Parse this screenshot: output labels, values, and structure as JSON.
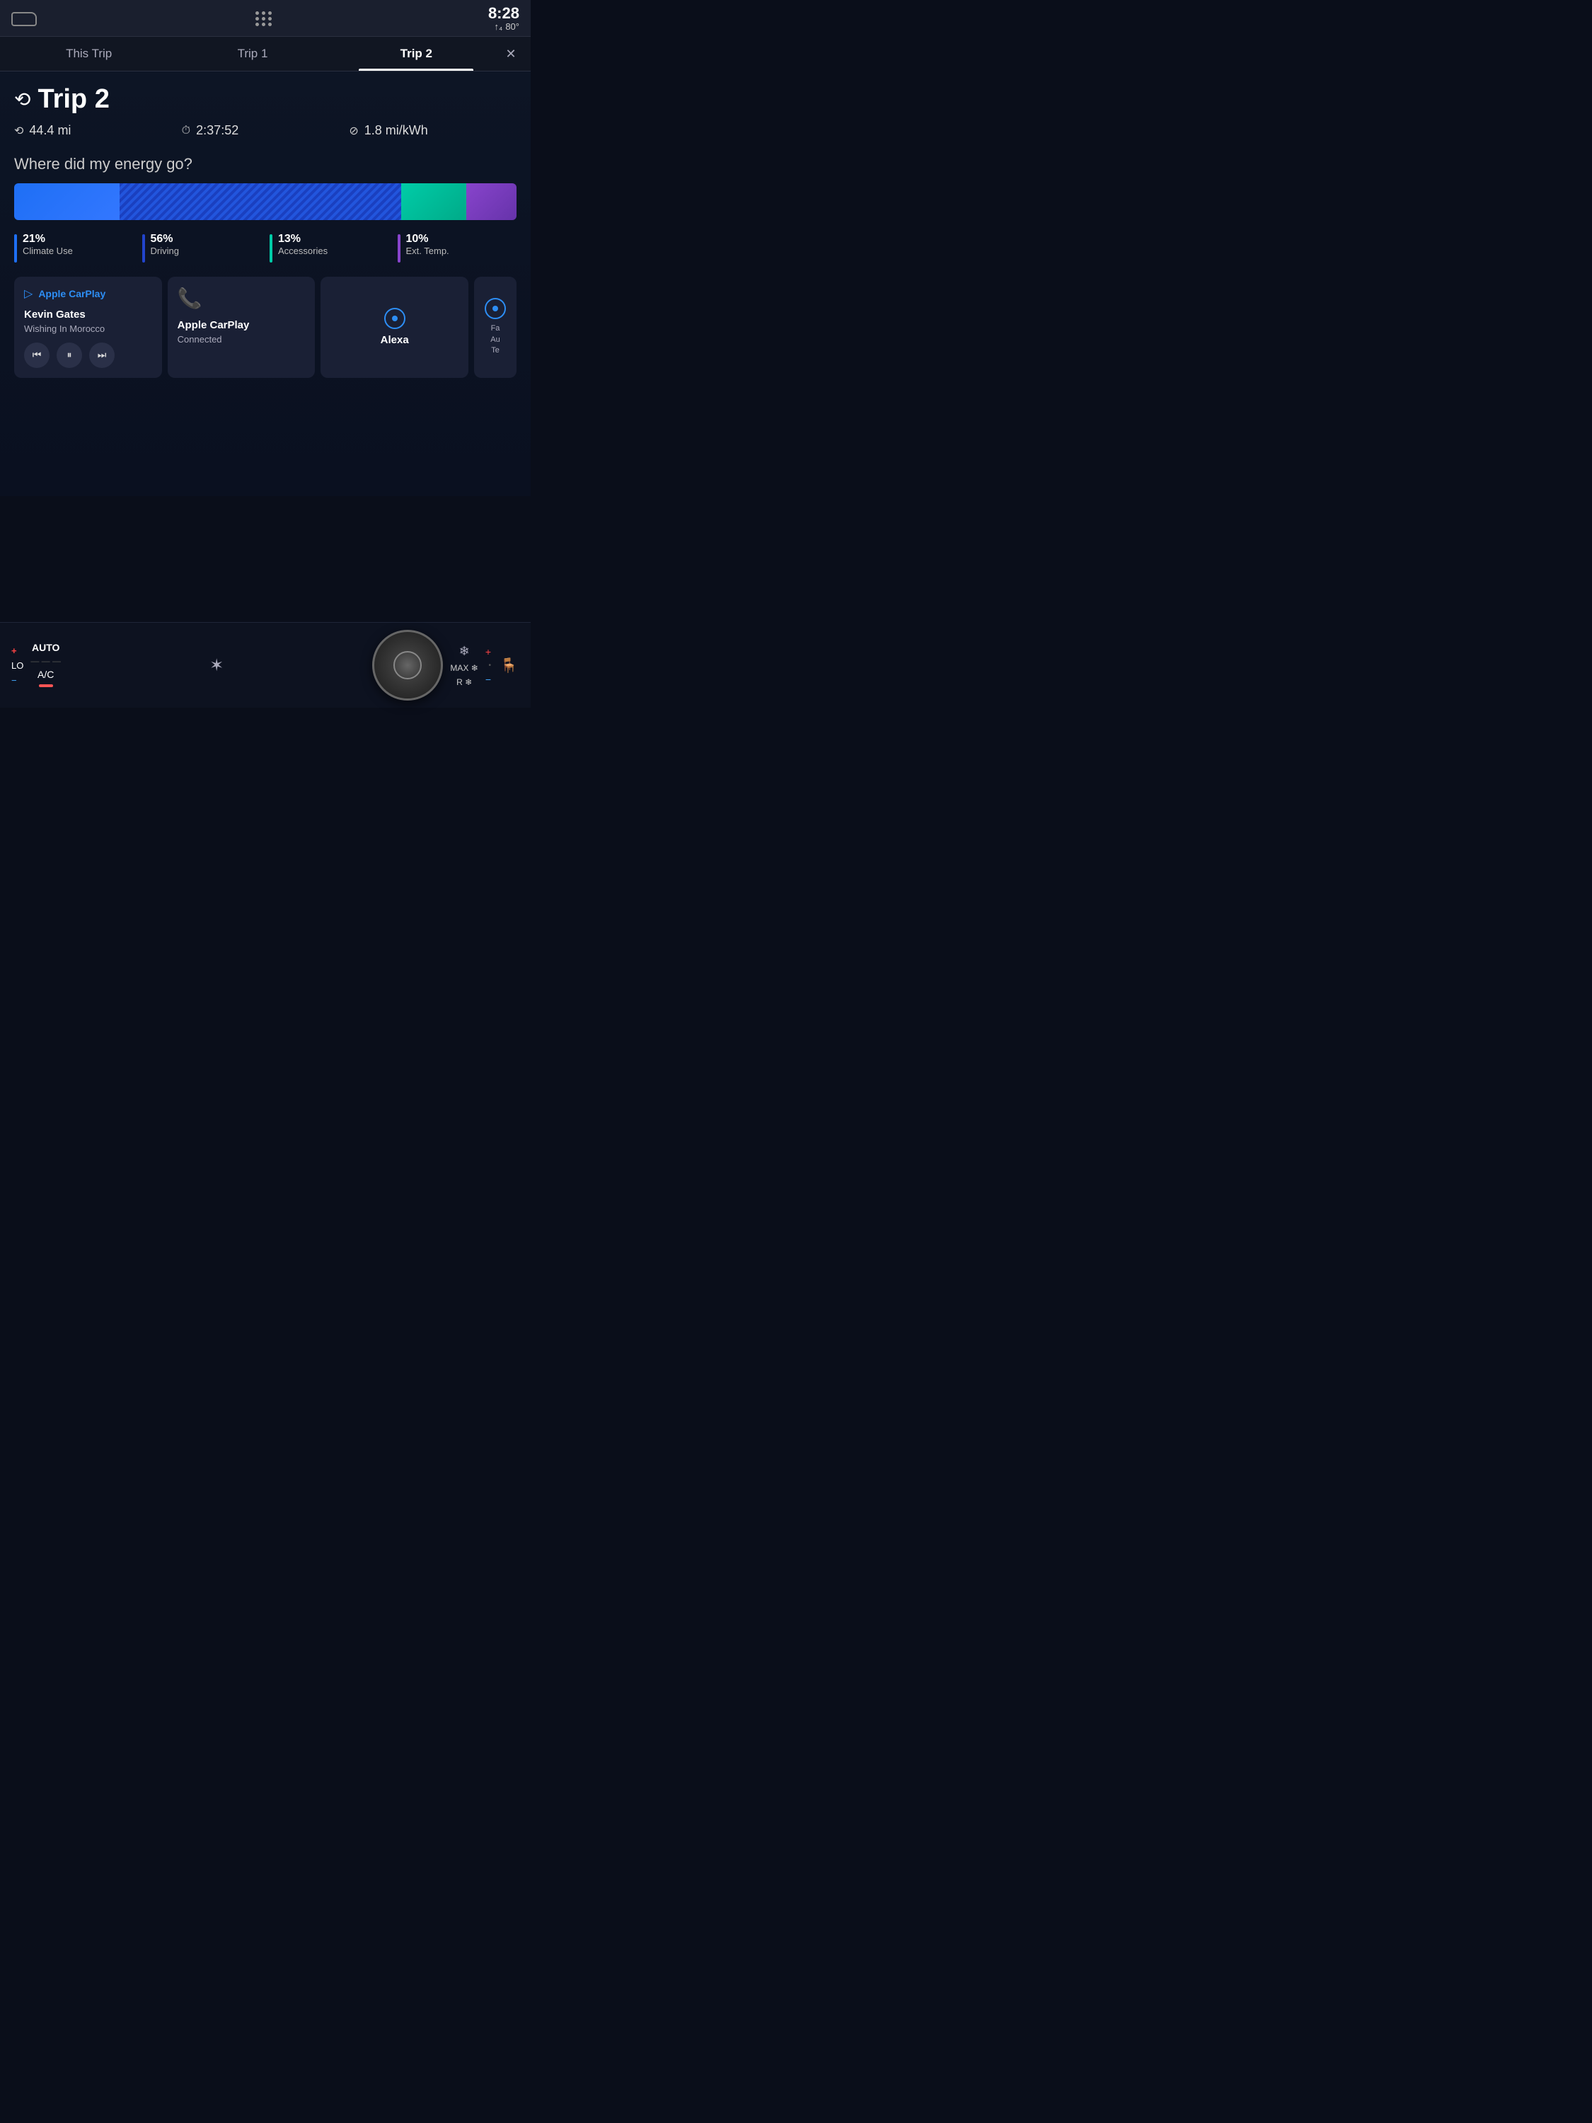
{
  "statusBar": {
    "time": "8:28",
    "temperature": "80°",
    "signalIcon": "signal-icon",
    "dotGridLabel": "apps-grid-icon"
  },
  "tabs": [
    {
      "id": "this-trip",
      "label": "This Trip",
      "active": false
    },
    {
      "id": "trip1",
      "label": "Trip 1",
      "active": false
    },
    {
      "id": "trip2",
      "label": "Trip 2",
      "active": true
    }
  ],
  "closeButton": "✕",
  "tripHeader": {
    "icon": "⟲",
    "title": "Trip 2"
  },
  "tripStats": [
    {
      "icon": "⟲",
      "value": "44.4 mi",
      "id": "distance"
    },
    {
      "icon": "⏱",
      "value": "2:37:52",
      "id": "duration"
    },
    {
      "icon": "⊘",
      "value": "1.8 mi/kWh",
      "id": "efficiency"
    }
  ],
  "energySection": {
    "title": "Where did my energy go?",
    "segments": [
      {
        "id": "climate",
        "percent": 21,
        "color": "#1e6ff5",
        "label": "Climate Use"
      },
      {
        "id": "driving",
        "percent": 56,
        "color": "#2244cc",
        "label": "Driving"
      },
      {
        "id": "accessories",
        "percent": 13,
        "color": "#00cca8",
        "label": "Accessories"
      },
      {
        "id": "exttemp",
        "percent": 10,
        "color": "#8844cc",
        "label": "Ext. Temp."
      }
    ]
  },
  "cards": {
    "carplay": {
      "icon": "▷",
      "title": "Apple CarPlay",
      "artist": "Kevin Gates",
      "song": "Wishing In Morocco",
      "controls": [
        "⏮",
        "⏸",
        "⏭"
      ]
    },
    "phone": {
      "icon": "📞",
      "line1": "Apple CarPlay",
      "line2": "Connected"
    },
    "alexa": {
      "label": "Alexa"
    },
    "side": {
      "lines": [
        "Fa",
        "Au",
        "Te"
      ]
    }
  },
  "bottomControls": {
    "plusLabel": "+",
    "loLabel": "LO",
    "minusLabel": "−",
    "autoLabel": "AUTO",
    "acLabel": "A/C",
    "fanIcon": "fan-icon",
    "defrostLabel": "MAX ❄",
    "rearDefrostLabel": "R ❄",
    "seatIcon": "seat-icon"
  },
  "colors": {
    "accent": "#2d8ef5",
    "background": "#0a0e1a",
    "cardBg": "#1a2035",
    "climateBlue": "#1e6ff5",
    "drivingBlue": "#2244cc",
    "accessoriesTeal": "#00cca8",
    "extTempPurple": "#8844cc"
  }
}
